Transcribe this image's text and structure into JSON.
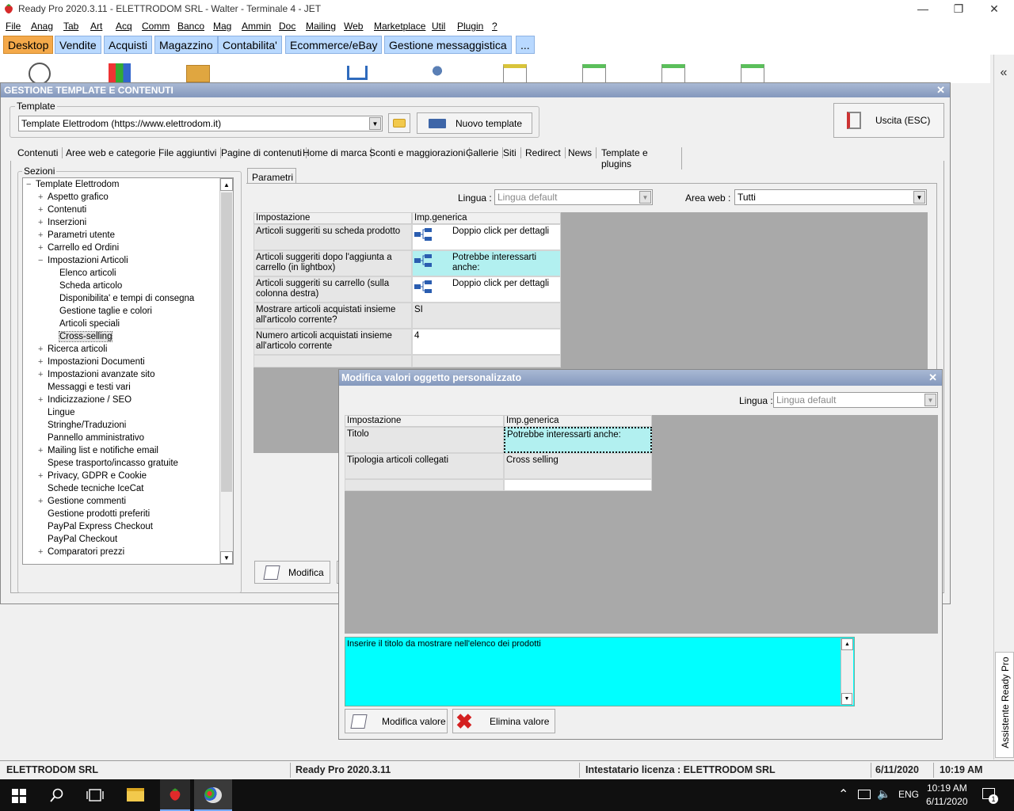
{
  "window": {
    "title": "Ready Pro 2020.3.11 - ELETTRODOM SRL - Walter - Terminale 4 - JET"
  },
  "menu": [
    "File",
    "Anag",
    "Tab",
    "Art",
    "Acq",
    "Comm",
    "Banco",
    "Mag",
    "Ammin",
    "Doc",
    "Mailing",
    "Web",
    "Marketplace",
    "Util",
    "Plugin",
    "?"
  ],
  "tabs": [
    "Desktop",
    "Vendite",
    "Acquisti",
    "Magazzino",
    "Contabilita'",
    "Ecommerce/eBay",
    "Gestione messaggistica",
    "..."
  ],
  "right_panel": {
    "collapse": "«",
    "assistant": "Assistente Ready Pro"
  },
  "main": {
    "title": "GESTIONE TEMPLATE E CONTENUTI",
    "template_label": "Template",
    "template_value": "Template Elettrodom (https://www.elettrodom.it)",
    "new_template": "Nuovo template",
    "exit": "Uscita (ESC)",
    "subtabs": [
      "Contenuti",
      "Aree web e categorie",
      "File aggiuntivi",
      "Pagine di contenuti",
      "Home di marca",
      "Sconti e maggiorazioni",
      "Gallerie",
      "Siti",
      "Redirect",
      "News",
      "Template e plugins"
    ],
    "sections_label": "Sezioni",
    "tree": [
      {
        "t": "Template Elettrodom",
        "lvl": 0,
        "exp": "−"
      },
      {
        "t": "Aspetto grafico",
        "lvl": 1,
        "exp": "+"
      },
      {
        "t": "Contenuti",
        "lvl": 1,
        "exp": "+"
      },
      {
        "t": "Inserzioni",
        "lvl": 1,
        "exp": "+"
      },
      {
        "t": "Parametri utente",
        "lvl": 1,
        "exp": "+"
      },
      {
        "t": "Carrello ed Ordini",
        "lvl": 1,
        "exp": "+"
      },
      {
        "t": "Impostazioni Articoli",
        "lvl": 1,
        "exp": "−"
      },
      {
        "t": "Elenco articoli",
        "lvl": 2,
        "exp": ""
      },
      {
        "t": "Scheda articolo",
        "lvl": 2,
        "exp": ""
      },
      {
        "t": "Disponibilita' e tempi di consegna",
        "lvl": 2,
        "exp": ""
      },
      {
        "t": "Gestione taglie e colori",
        "lvl": 2,
        "exp": ""
      },
      {
        "t": "Articoli speciali",
        "lvl": 2,
        "exp": ""
      },
      {
        "t": "Cross-selling",
        "lvl": 2,
        "exp": "",
        "sel": true
      },
      {
        "t": "Ricerca articoli",
        "lvl": 1,
        "exp": "+"
      },
      {
        "t": "Impostazioni Documenti",
        "lvl": 1,
        "exp": "+"
      },
      {
        "t": "Impostazioni avanzate sito",
        "lvl": 1,
        "exp": "+"
      },
      {
        "t": "Messaggi e testi vari",
        "lvl": 1,
        "exp": ""
      },
      {
        "t": "Indicizzazione / SEO",
        "lvl": 1,
        "exp": "+"
      },
      {
        "t": "Lingue",
        "lvl": 1,
        "exp": ""
      },
      {
        "t": "Stringhe/Traduzioni",
        "lvl": 1,
        "exp": ""
      },
      {
        "t": "Pannello amministrativo",
        "lvl": 1,
        "exp": ""
      },
      {
        "t": "Mailing list e notifiche email",
        "lvl": 1,
        "exp": "+"
      },
      {
        "t": "Spese trasporto/incasso gratuite",
        "lvl": 1,
        "exp": ""
      },
      {
        "t": "Privacy, GDPR e Cookie",
        "lvl": 1,
        "exp": "+"
      },
      {
        "t": "Schede tecniche IceCat",
        "lvl": 1,
        "exp": ""
      },
      {
        "t": "Gestione commenti",
        "lvl": 1,
        "exp": "+"
      },
      {
        "t": "Gestione prodotti preferiti",
        "lvl": 1,
        "exp": ""
      },
      {
        "t": "PayPal Express Checkout",
        "lvl": 1,
        "exp": ""
      },
      {
        "t": "PayPal Checkout",
        "lvl": 1,
        "exp": ""
      },
      {
        "t": "Comparatori prezzi",
        "lvl": 1,
        "exp": "+"
      }
    ],
    "params_tab": "Parametri",
    "lingua_label": "Lingua :",
    "lingua_value": "Lingua default",
    "area_label": "Area web :",
    "area_value": "Tutti",
    "grid_headers": [
      "Impostazione",
      "Imp.generica"
    ],
    "rows": [
      {
        "label": "Articoli suggeriti su scheda prodotto",
        "value": "Doppio click per dettagli",
        "icon": true
      },
      {
        "label": "Articoli suggeriti dopo l'aggiunta a carrello (in lightbox)",
        "value": "Potrebbe interessarti anche:",
        "icon": true,
        "sel": true
      },
      {
        "label": "Articoli suggeriti su carrello (sulla colonna destra)",
        "value": "Doppio click per dettagli",
        "icon": true
      },
      {
        "label": "Mostrare articoli acquistati insieme all'articolo corrente?",
        "value": "SI",
        "icon": false
      },
      {
        "label": "Numero articoli acquistati insieme all'articolo corrente",
        "value": "4",
        "icon": false
      }
    ],
    "modify": "Modifica"
  },
  "dialog": {
    "title": "Modifica valori oggetto personalizzato",
    "lingua_label": "Lingua :",
    "lingua_value": "Lingua default",
    "headers": [
      "Impostazione",
      "Imp.generica"
    ],
    "rows": [
      {
        "label": "Titolo",
        "value": "Potrebbe interessarti anche:",
        "sel": true
      },
      {
        "label": "Tipologia articoli collegati",
        "value": "Cross selling"
      }
    ],
    "help_text": "Inserire il titolo da mostrare nell'elenco dei prodotti",
    "modify_value": "Modifica valore",
    "delete_value": "Elimina valore"
  },
  "status": {
    "company": "ELETTRODOM SRL",
    "version": "Ready Pro 2020.3.11",
    "license": "Intestatario licenza : ELETTRODOM SRL",
    "date": "6/11/2020",
    "time": "10:19 AM"
  },
  "taskbar": {
    "lang": "ENG",
    "time": "10:19 AM",
    "date": "6/11/2020",
    "notif": "1"
  },
  "colors": {
    "tab_active": "#f4a94a",
    "tab": "#b9d9ff",
    "selected_cell": "#b2f0f0",
    "help_bg": "#00ffff",
    "title_grad": "#8498bd"
  }
}
